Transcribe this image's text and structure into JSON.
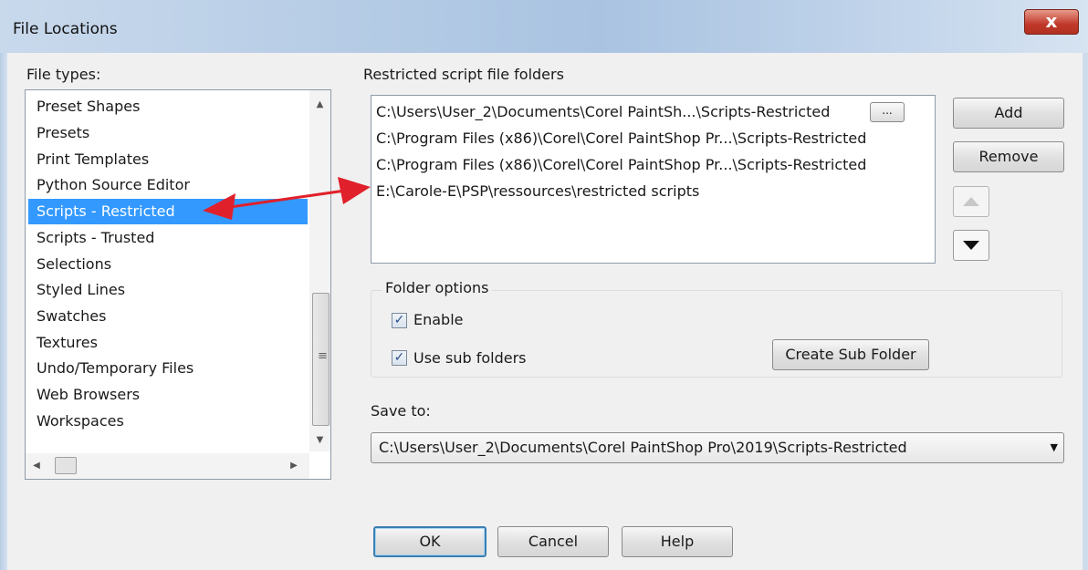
{
  "window": {
    "title": "File Locations",
    "close_glyph": "x"
  },
  "file_types": {
    "label": "File types:",
    "items": [
      "Preset Shapes",
      "Presets",
      "Print Templates",
      "Python Source Editor",
      "Scripts - Restricted",
      "Scripts - Trusted",
      "Selections",
      "Styled Lines",
      "Swatches",
      "Textures",
      "Undo/Temporary Files",
      "Web Browsers",
      "Workspaces"
    ],
    "selected_item": "Scripts - Restricted"
  },
  "folders": {
    "label": "Restricted script file folders",
    "items": [
      "C:\\Users\\User_2\\Documents\\Corel PaintSh...\\Scripts-Restricted",
      "C:\\Program Files (x86)\\Corel\\Corel PaintShop Pr...\\Scripts-Restricted",
      "C:\\Program Files (x86)\\Corel\\Corel PaintShop Pr...\\Scripts-Restricted",
      "E:\\Carole-E\\PSP\\ressources\\restricted scripts"
    ],
    "browse_label": "..."
  },
  "side_buttons": {
    "add": "Add",
    "remove": "Remove"
  },
  "folder_options": {
    "title": "Folder options",
    "enable_label": "Enable",
    "enable_checked": true,
    "subfolders_label": "Use sub folders",
    "subfolders_checked": true,
    "create_sub_folder": "Create Sub Folder"
  },
  "save_to": {
    "label": "Save to:",
    "value": "C:\\Users\\User_2\\Documents\\Corel PaintShop Pro\\2019\\Scripts-Restricted"
  },
  "footer": {
    "ok": "OK",
    "cancel": "Cancel",
    "help": "Help"
  },
  "icons": {
    "checkmark": "✓",
    "close": "close-icon",
    "up": "arrow-up-icon",
    "down": "arrow-down-icon"
  },
  "colors": {
    "selection": "#3399ff",
    "annotation_arrow": "#e0202a",
    "close_button": "#c0392b"
  }
}
